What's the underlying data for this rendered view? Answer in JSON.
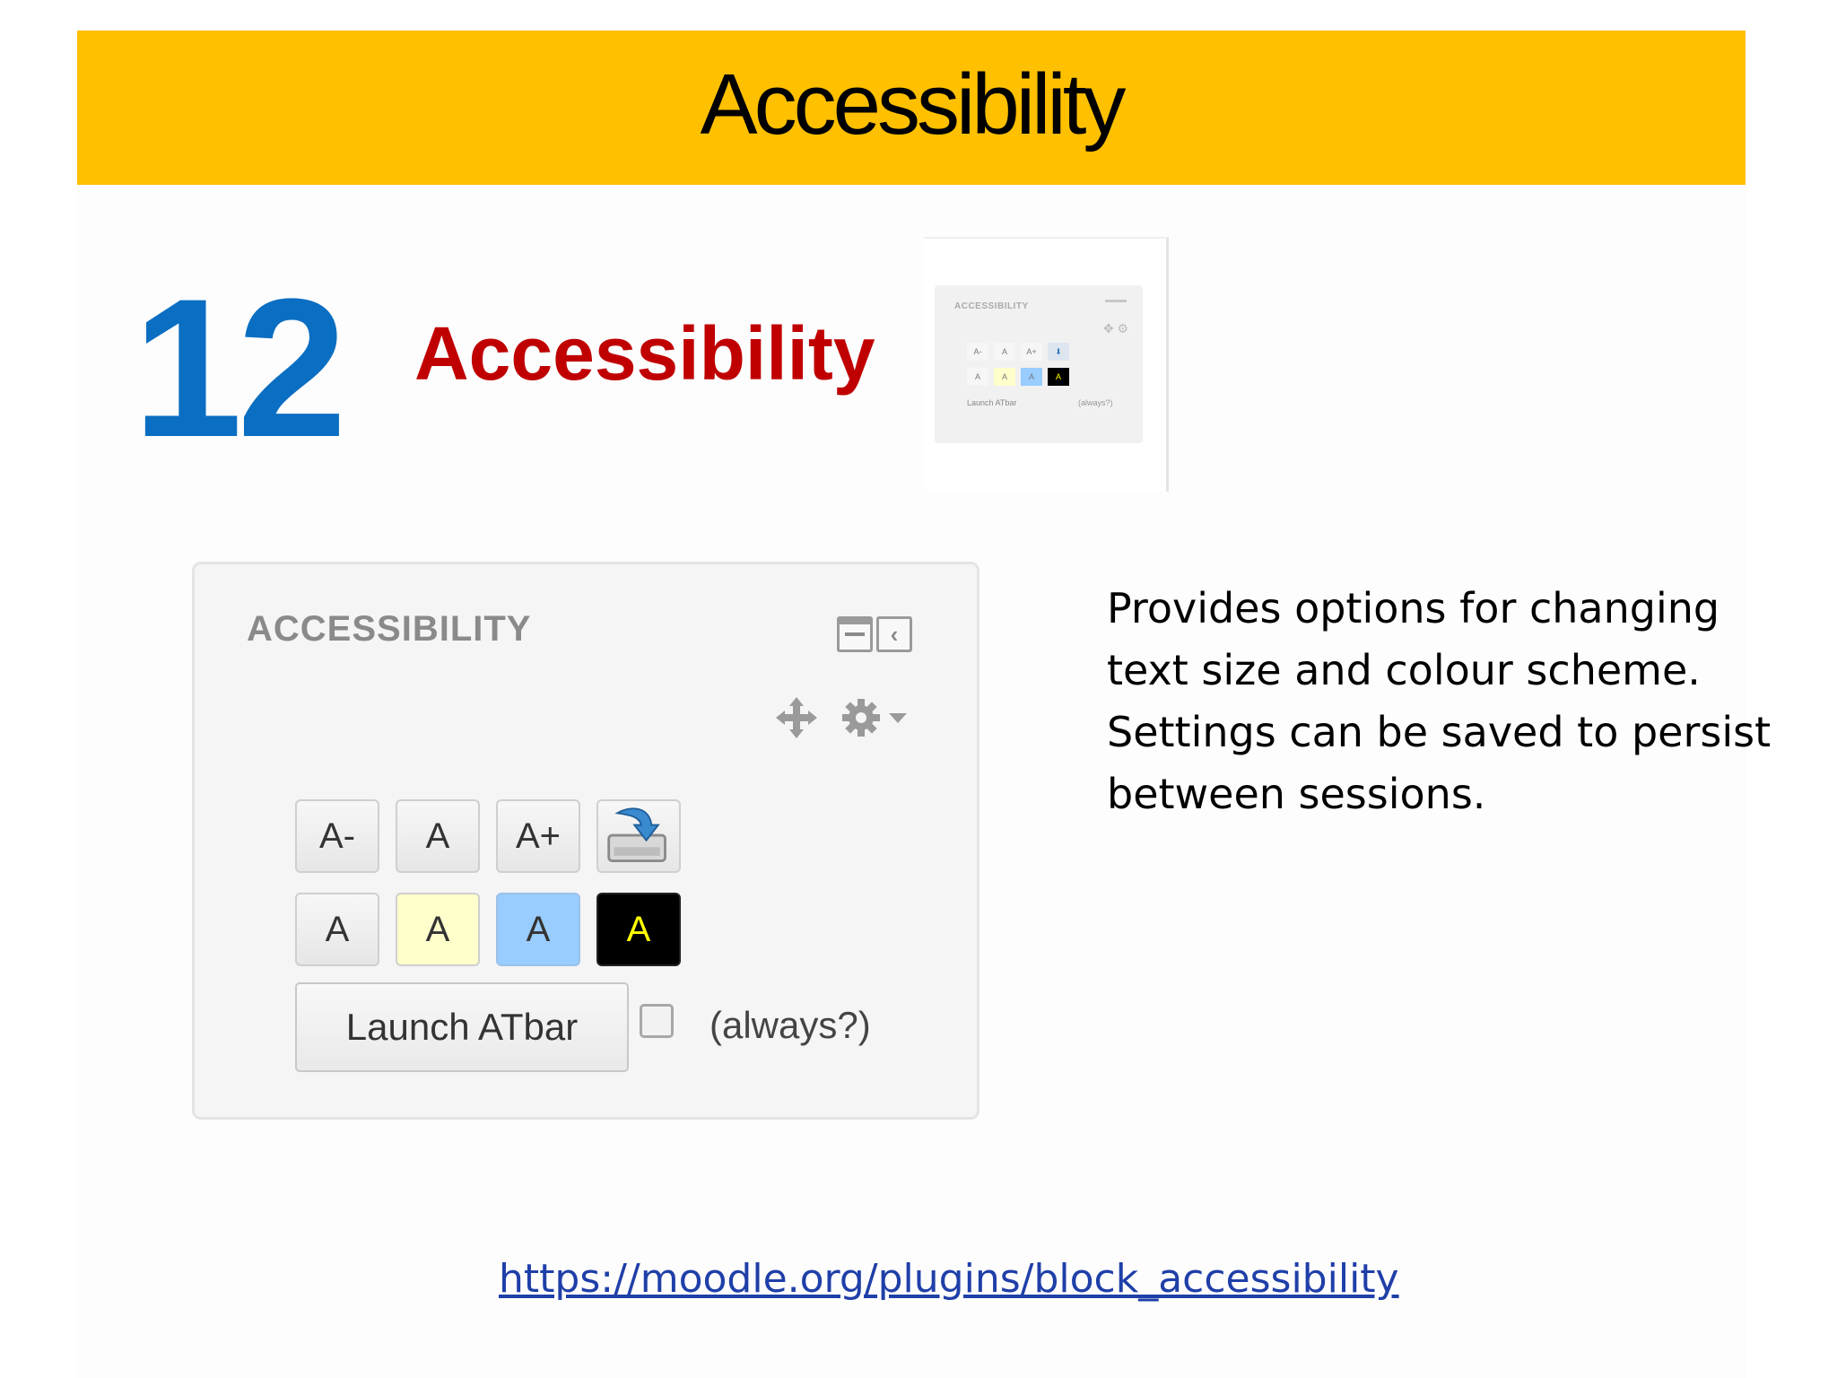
{
  "slide": {
    "title": "Accessibility",
    "number": "12",
    "plugin_name": "Accessibility",
    "description_lines": [
      "Provides options for changing",
      "text size and colour scheme.",
      "Settings can be saved to persist",
      "between sessions."
    ],
    "link": "https://moodle.org/plugins/block_accessibility"
  },
  "colors": {
    "header_bg": "#FFC000",
    "number": "#0A6EC2",
    "plugin_name": "#C00000",
    "link": "#1F3FA8"
  },
  "block": {
    "title": "ACCESSIBILITY",
    "icons": [
      "collapse-icon",
      "dock-icon",
      "move-icon",
      "gear-icon",
      "chevron-down-icon",
      "save-settings-icon"
    ],
    "size_buttons": [
      "A-",
      "A",
      "A+"
    ],
    "scheme_buttons": [
      {
        "label": "A",
        "bg": "#eeeeee",
        "fg": "#333333"
      },
      {
        "label": "A",
        "bg": "#FFFFCC",
        "fg": "#333333"
      },
      {
        "label": "A",
        "bg": "#99CCFF",
        "fg": "#333333"
      },
      {
        "label": "A",
        "bg": "#000000",
        "fg": "#FFFF00"
      }
    ],
    "launch_label": "Launch ATbar",
    "always_label": "(always?)",
    "always_checked": false
  }
}
